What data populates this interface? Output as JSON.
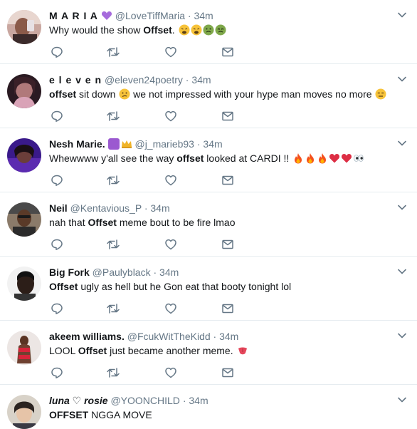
{
  "icons": {
    "reply": "reply-icon",
    "retweet": "retweet-icon",
    "like": "heart-icon",
    "dm": "envelope-icon",
    "more": "chevron-down-icon"
  },
  "colors": {
    "name": "#14171a",
    "meta": "#657786",
    "divider": "#e6ecf0",
    "icon": "#657786"
  },
  "tweets": [
    {
      "name": "M A R I A",
      "handle": "@LoveTiffMaria",
      "time": "34m",
      "segments": [
        {
          "t": "Why would the show "
        },
        {
          "b": "Offset"
        },
        {
          "t": "."
        }
      ]
    },
    {
      "name": "e l e v e n",
      "handle": "@eleven24poetry",
      "time": "34m",
      "segments": [
        {
          "b": "offset"
        },
        {
          "t": " sit down "
        },
        {
          "t": " we not impressed with your hype man moves no more "
        }
      ]
    },
    {
      "name": "Nesh Marie.",
      "handle": "@j_marieb93",
      "time": "34m",
      "segments": [
        {
          "t": "Whewwww y'all see the way "
        },
        {
          "b": "offset"
        },
        {
          "t": " looked at CARDI !! "
        }
      ]
    },
    {
      "name": "Neil",
      "handle": "@Kentavious_P",
      "time": "34m",
      "segments": [
        {
          "t": "nah that "
        },
        {
          "b": "Offset"
        },
        {
          "t": " meme bout to be fire lmao"
        }
      ]
    },
    {
      "name": "Big Fork",
      "handle": "@Paulyblack",
      "time": "34m",
      "segments": [
        {
          "b": "Offset"
        },
        {
          "t": " ugly as hell but he Gon eat that booty tonight lol"
        }
      ]
    },
    {
      "name": "akeem williams.",
      "handle": "@FcukWitTheKidd",
      "time": "34m",
      "segments": [
        {
          "t": "LOOL "
        },
        {
          "b": "Offset"
        },
        {
          "t": " just became another meme. "
        }
      ]
    },
    {
      "name": "luna ♡ rosie",
      "handle": "@YOONCHILD",
      "time": "34m",
      "segments": [
        {
          "b": "OFFSET"
        },
        {
          "t": " NGGA MOVE"
        }
      ]
    }
  ]
}
